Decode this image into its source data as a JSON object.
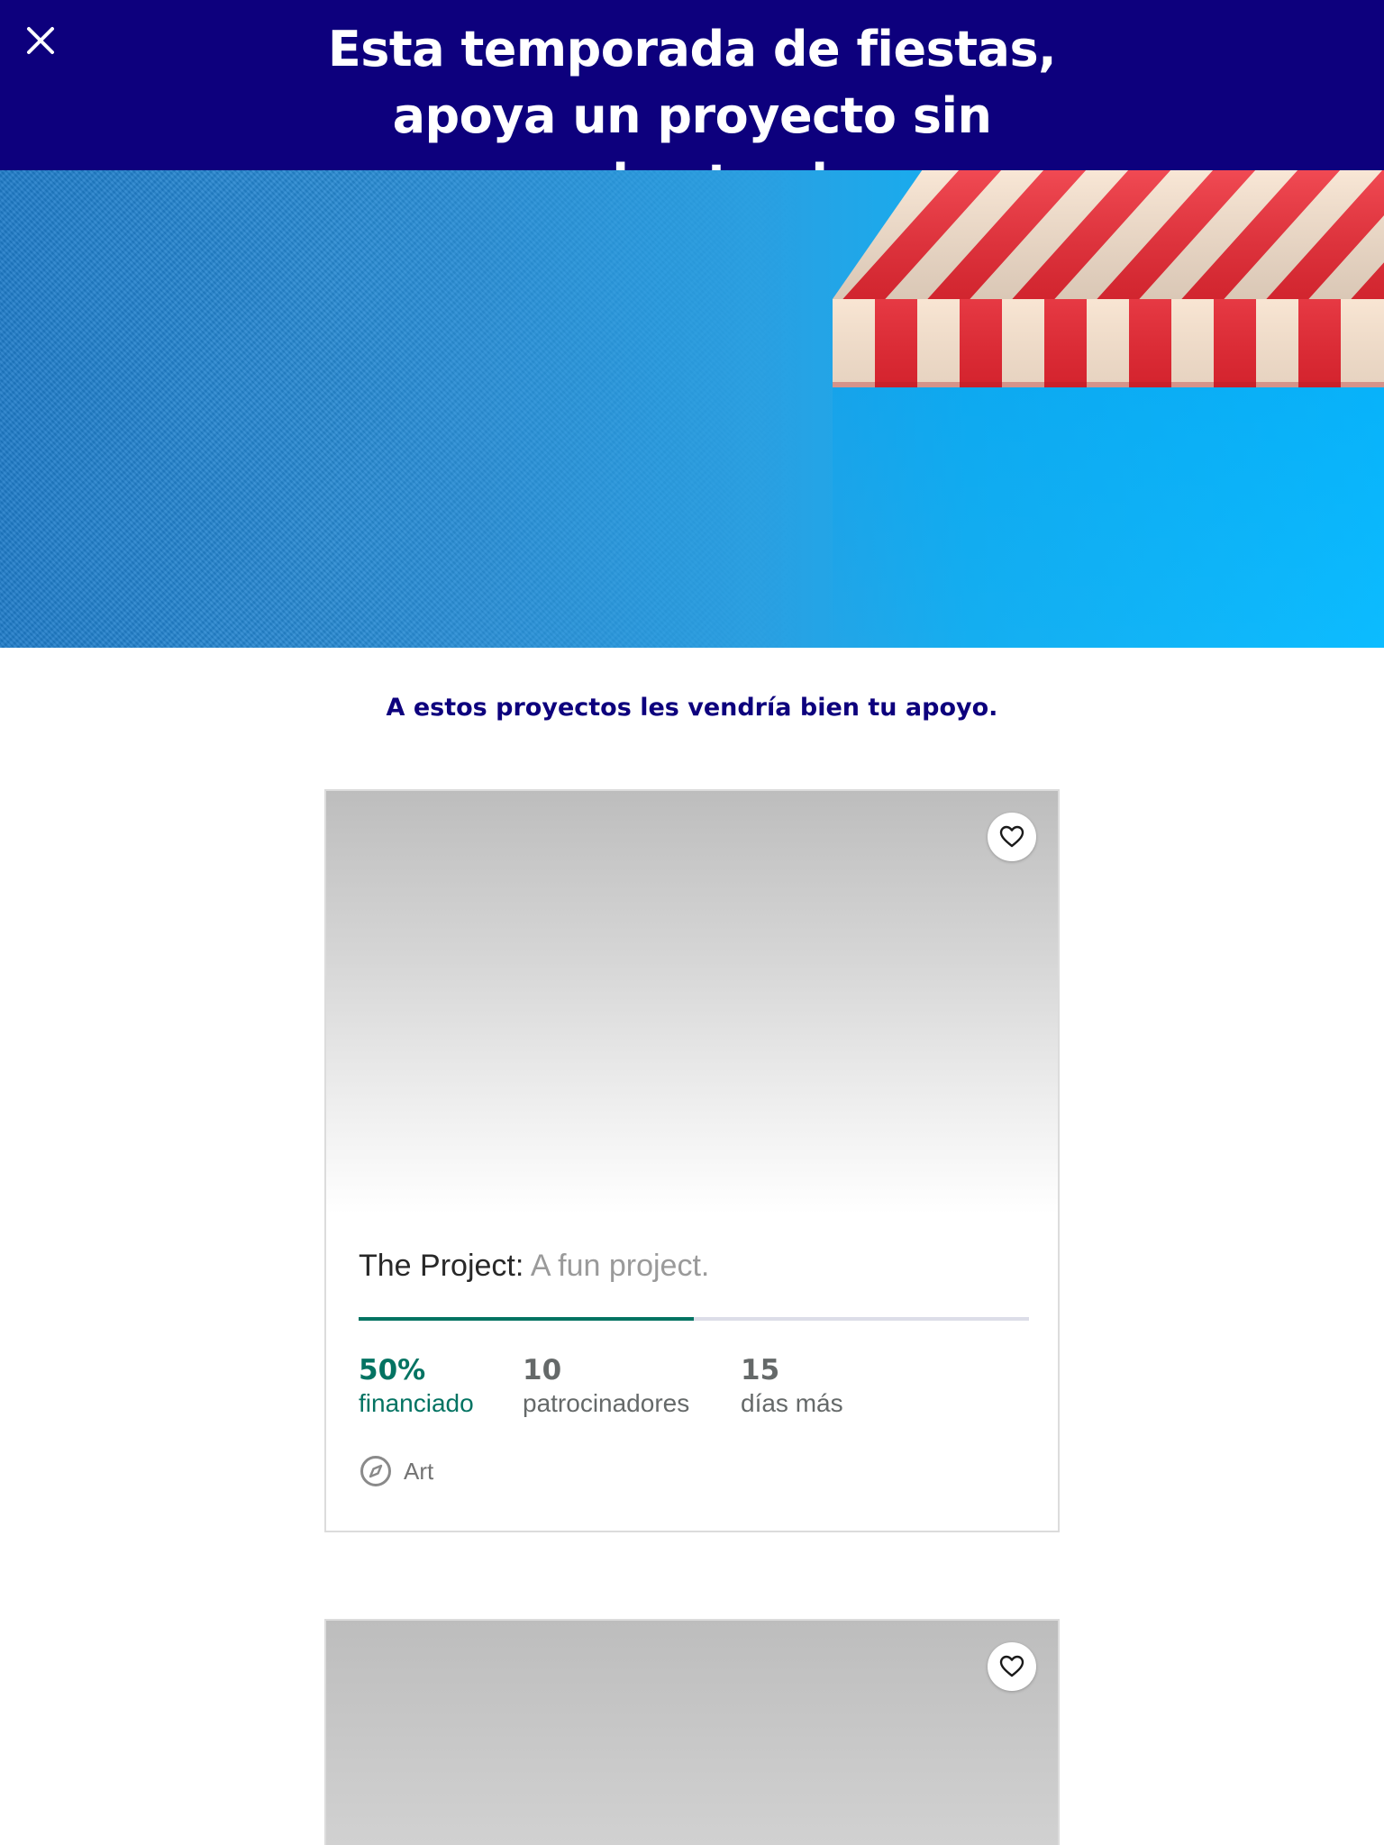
{
  "banner": {
    "title_line1": "Esta temporada de fiestas,",
    "title_line2": "apoya un proyecto sin",
    "title_line3": "apoyo hasta ahora.",
    "close_icon": "close-icon",
    "background_color": "#0d007d"
  },
  "hero": {
    "illustration": "striped-awning"
  },
  "section": {
    "subtitle": "A estos proyectos les vendría bien tu apoyo."
  },
  "projects": [
    {
      "name": "The Project:",
      "blurb": "A fun project.",
      "progress": 0.5,
      "funded_value": "50%",
      "funded_label": "financiado",
      "backers_value": "10",
      "backers_label": "patrocinadores",
      "days_value": "15",
      "days_label": "días más",
      "category": "Art",
      "category_icon": "compass-icon",
      "favorite_icon": "heart-icon"
    },
    {
      "favorite_icon": "heart-icon"
    }
  ],
  "colors": {
    "accent_green": "#037362",
    "brand_navy": "#0d007d",
    "progress_track": "#dcdde8"
  }
}
